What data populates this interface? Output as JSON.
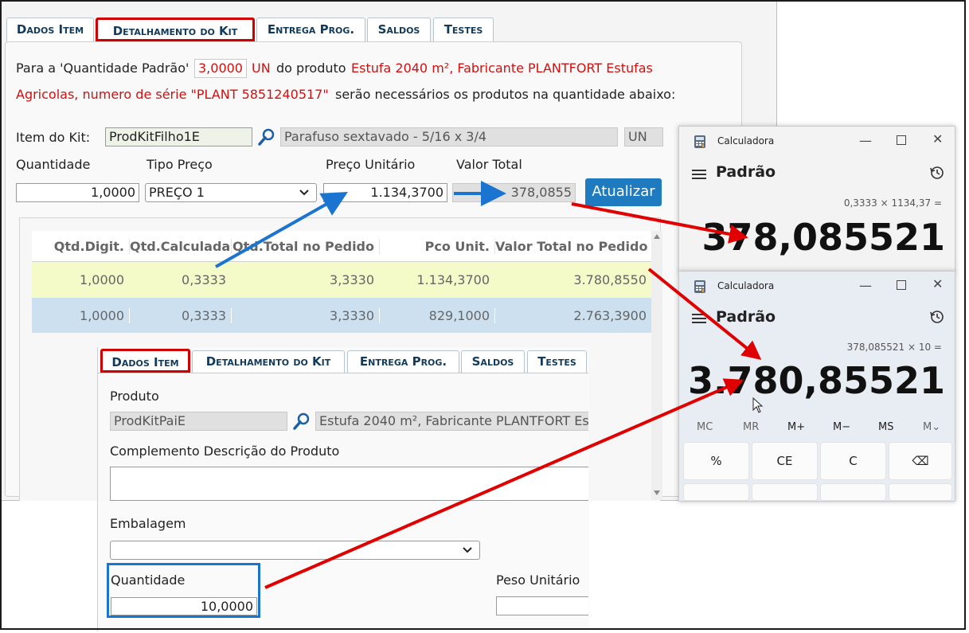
{
  "tabs": [
    {
      "label": "Dados Item"
    },
    {
      "label": "Detalhamento do Kit"
    },
    {
      "label": "Entrega Prog."
    },
    {
      "label": "Saldos"
    },
    {
      "label": "Testes"
    }
  ],
  "intro": {
    "p1": "Para a 'Quantidade Padrão'",
    "qty": "3,0000",
    "unit": "UN",
    "p2": "do produto",
    "product_red_1": "Estufa 2040 m², Fabricante PLANTFORT Estufas",
    "product_red_2": "Agricolas, numero de série \"PLANT 5851240517\"",
    "p3": "serão necessários os produtos na quantidade abaixo:"
  },
  "kit": {
    "item_label": "Item do Kit:",
    "item_code": "ProdKitFilho1E",
    "item_desc": "Parafuso sextavado - 5/16 x 3/4",
    "item_unit": "UN",
    "qty_label": "Quantidade",
    "price_type_label": "Tipo Preço",
    "unit_price_label": "Preço Unitário",
    "total_label": "Valor Total",
    "qty_value": "1,0000",
    "price_type_value": "PREÇO 1",
    "unit_price_value": "1.134,3700",
    "total_value": "378,0855",
    "update_button": "Atualizar"
  },
  "grid": {
    "headers": [
      "Qtd.Digit.",
      "Qtd.Calculada",
      "Qtd.Total no Pedido",
      "Pco Unit.",
      "Valor Total no Pedido"
    ],
    "rows": [
      [
        "1,0000",
        "0,3333",
        "3,3330",
        "1.134,3700",
        "3.780,8550"
      ],
      [
        "1,0000",
        "0,3333",
        "3,3330",
        "829,1000",
        "2.763,3900"
      ]
    ]
  },
  "calc1": {
    "title": "Calculadora",
    "mode": "Padrão",
    "expression": "0,3333 × 1134,37 =",
    "display": "378,085521"
  },
  "calc2": {
    "title": "Calculadora",
    "mode": "Padrão",
    "expression": "378,085521 × 10 =",
    "display": "3.780,85521",
    "memory": [
      "MC",
      "MR",
      "M+",
      "M−",
      "MS",
      "M⌄"
    ],
    "keys": [
      "%",
      "CE",
      "C",
      "⌫"
    ]
  },
  "sub": {
    "tabs": [
      {
        "label": "Dados Item"
      },
      {
        "label": "Detalhamento do Kit"
      },
      {
        "label": "Entrega Prog."
      },
      {
        "label": "Saldos"
      },
      {
        "label": "Testes"
      }
    ],
    "product_label": "Produto",
    "product_code": "ProdKitPaiE",
    "product_desc": "Estufa 2040 m², Fabricante PLANTFORT Es",
    "complement_label": "Complemento Descrição do Produto",
    "packaging_label": "Embalagem",
    "quantity_label": "Quantidade",
    "quantity_value": "10,0000",
    "unit_weight_label": "Peso Unitário"
  },
  "colors": {
    "highlight_red": "#d10000",
    "highlight_blue": "#1b75d0",
    "button_blue": "#1e7bbf",
    "row_yellow": "#f4fac8",
    "row_blue": "#cde0f0"
  }
}
